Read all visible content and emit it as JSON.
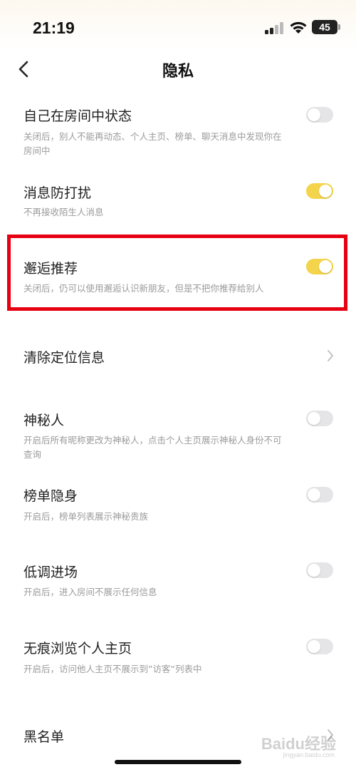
{
  "status_bar": {
    "time": "21:19",
    "battery": "45"
  },
  "nav": {
    "title": "隐私"
  },
  "settings": [
    {
      "title": "自己在房间中状态",
      "desc_line1": "关闭后，别人不能再动态、个人主页、榜单、聊天消息中发现你在",
      "desc_line2": "房间中",
      "toggle": "off"
    },
    {
      "title": "消息防打扰",
      "desc_line1": "不再接收陌生人消息",
      "toggle": "on"
    },
    {
      "title": "邂逅推荐",
      "desc_line1": "关闭后，仍可以使用邂逅认识新朋友，但是不把你推荐给别人",
      "toggle": "on"
    },
    {
      "title": "清除定位信息"
    },
    {
      "title": "神秘人",
      "desc_line1": "开启后所有昵称更改为神秘人，点击个人主页展示神秘人身份不可",
      "desc_line2": "查询",
      "toggle": "off"
    },
    {
      "title": "榜单隐身",
      "desc_line1": "开启后，榜单列表展示神秘贵族",
      "toggle": "off"
    },
    {
      "title": "低调进场",
      "desc_line1": "开启后，进入房间不展示任何信息",
      "toggle": "off"
    },
    {
      "title": "无痕浏览个人主页",
      "desc_line1": "开启后，访问他人主页不展示到”访客“列表中",
      "toggle": "off"
    },
    {
      "title": "黑名单"
    }
  ],
  "colors": {
    "toggle_on": "#f3d44a",
    "toggle_off": "#e5e5e7",
    "highlight": "#e60012"
  },
  "watermark": {
    "text": "Baidu经验",
    "sub": "jingyan.baidu.com"
  }
}
